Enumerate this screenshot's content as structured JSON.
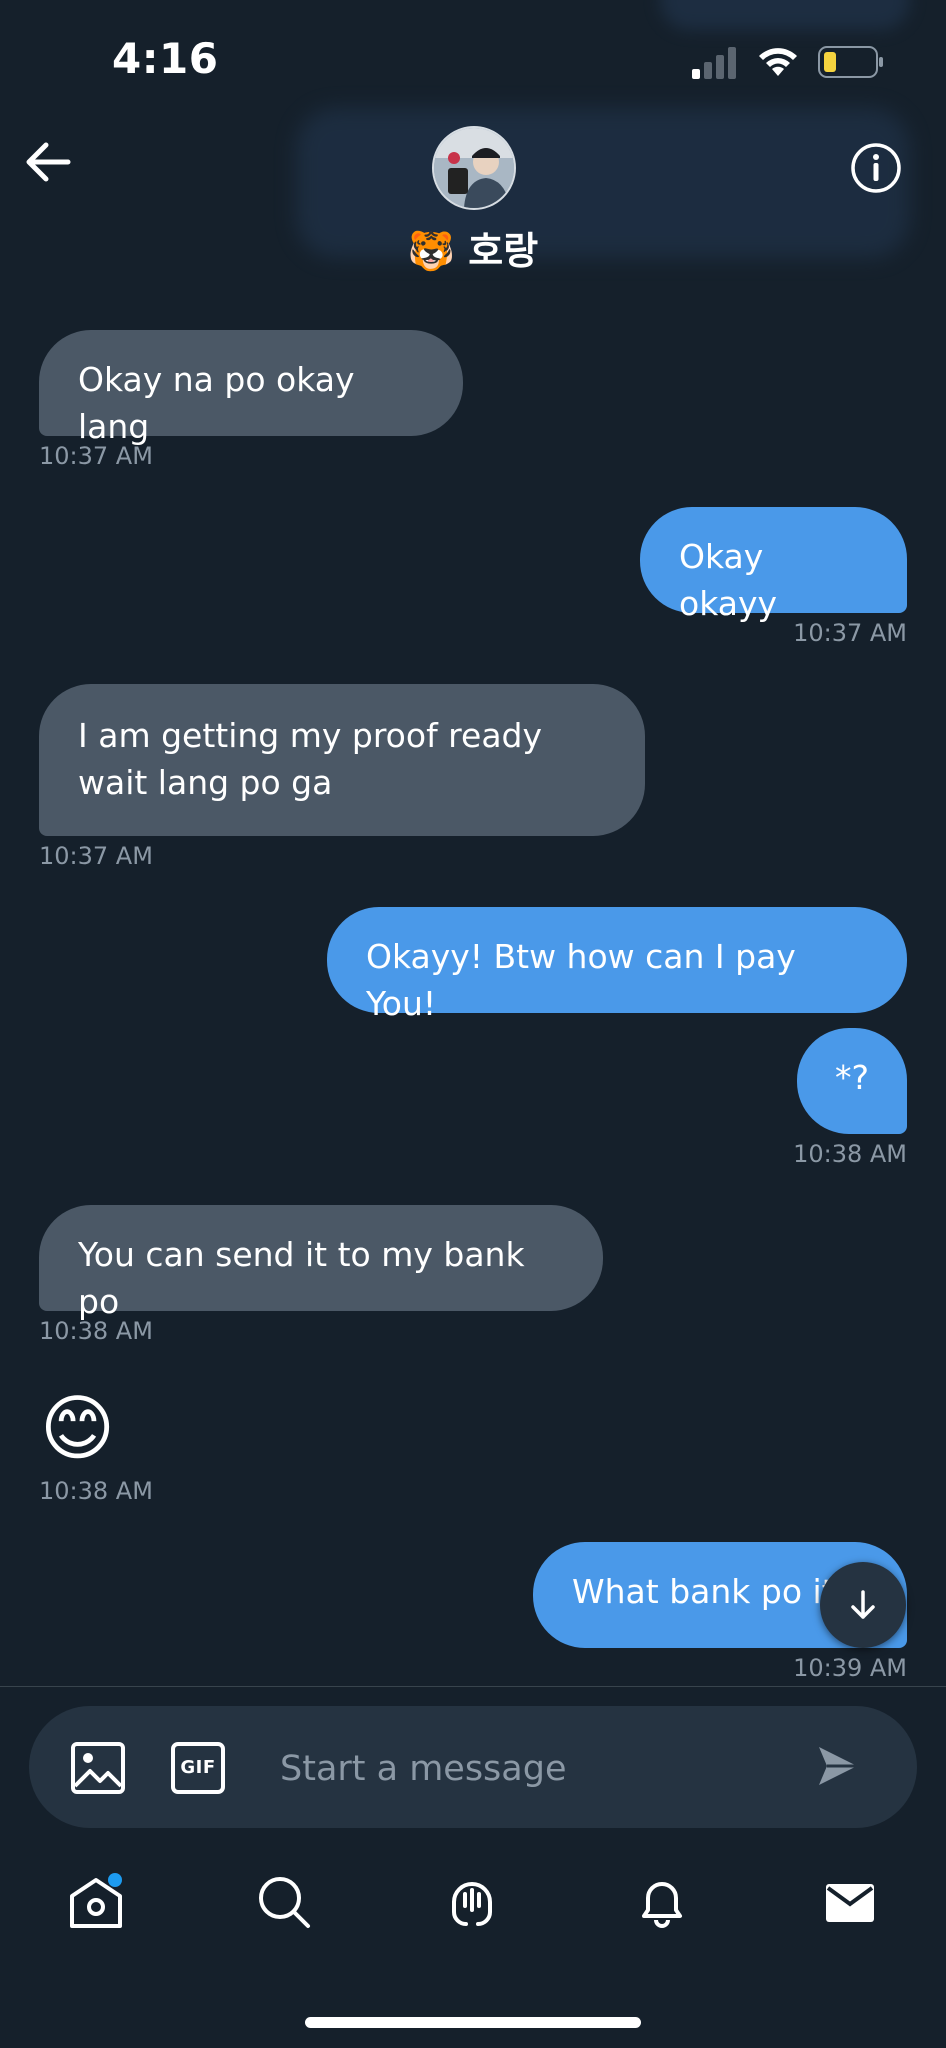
{
  "status_bar": {
    "time": "4:16"
  },
  "header": {
    "name": "🐯 호랑"
  },
  "messages": [
    {
      "direction": "received",
      "text": "Okay na po okay lang",
      "time": "10:37 AM"
    },
    {
      "direction": "sent",
      "text": "Okay okayy",
      "time": "10:37 AM"
    },
    {
      "direction": "received",
      "text": "I am getting my proof ready wait lang po ga",
      "time": "10:37 AM"
    },
    {
      "direction": "sent",
      "text": "Okayy! Btw how can I pay You!",
      "time": ""
    },
    {
      "direction": "sent",
      "text": "*?",
      "time": "10:38 AM"
    },
    {
      "direction": "received",
      "text": "You can send it to my bank po",
      "time": "10:38 AM"
    },
    {
      "direction": "received",
      "text": "😊",
      "time": "10:38 AM"
    },
    {
      "direction": "sent",
      "text": "What bank po it",
      "time": "10:39 AM"
    }
  ],
  "composer": {
    "placeholder": "Start a message",
    "gif_label": "GIF"
  },
  "colors": {
    "background": "#15202b",
    "sent_bubble": "#4a99e9",
    "received_bubble": "#4b5866",
    "accent": "#1d9bf0"
  },
  "icons": [
    "back-arrow-icon",
    "info-icon",
    "image-icon",
    "gif-icon",
    "send-icon",
    "home-icon",
    "search-icon",
    "spaces-icon",
    "notifications-icon",
    "messages-icon",
    "scroll-down-icon"
  ]
}
